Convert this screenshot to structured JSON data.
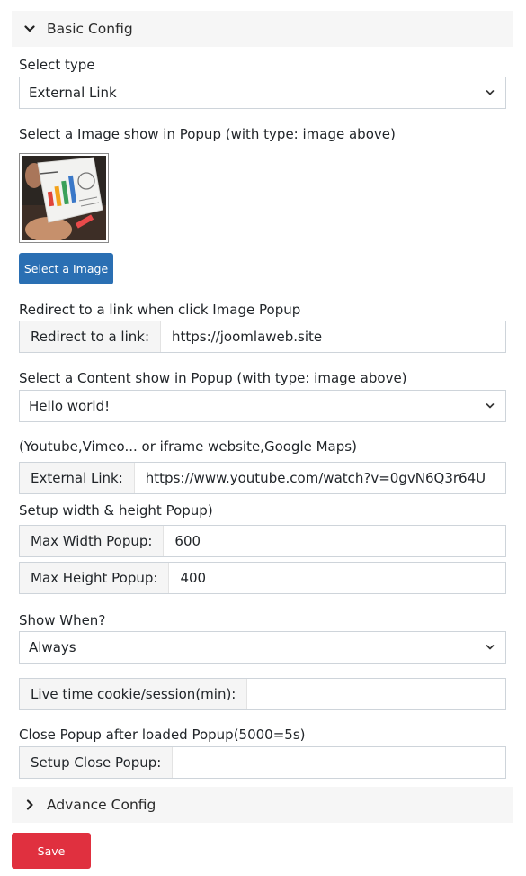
{
  "basic_config": {
    "title": "Basic Config"
  },
  "select_type": {
    "label": "Select type",
    "value": "External Link"
  },
  "image_section": {
    "label": "Select a Image show in Popup (with type: image above)",
    "button": "Select a Image"
  },
  "redirect": {
    "label": "Redirect to a link when click Image Popup",
    "addon": "Redirect to a link:",
    "value": "https://joomlaweb.site"
  },
  "content_select": {
    "label": "Select a Content show in Popup (with type: image above)",
    "value": "Hello world!"
  },
  "external": {
    "label": "(Youtube,Vimeo... or iframe website,Google Maps)",
    "addon": "External Link:",
    "value": "https://www.youtube.com/watch?v=0gvN6Q3r64U"
  },
  "size": {
    "label": "Setup width & height Popup)",
    "width_addon": "Max Width Popup:",
    "width_value": "600",
    "height_addon": "Max Height Popup:",
    "height_value": "400"
  },
  "show_when": {
    "label": "Show When?",
    "value": "Always"
  },
  "cookie": {
    "addon": "Live time cookie/session(min):",
    "value": ""
  },
  "close_popup": {
    "label": "Close Popup after loaded Popup(5000=5s)",
    "addon": "Setup Close Popup:",
    "value": ""
  },
  "advance_config": {
    "title": "Advance Config"
  },
  "save": {
    "label": "Save"
  },
  "icons": {
    "section_open": "chevron-down-icon",
    "section_closed": "chevron-right-icon",
    "select_caret": "chevron-down-icon"
  },
  "colors": {
    "primary_button": "#2a6fb3",
    "save_button": "#e0303f",
    "header_bg": "#f6f6f6"
  }
}
